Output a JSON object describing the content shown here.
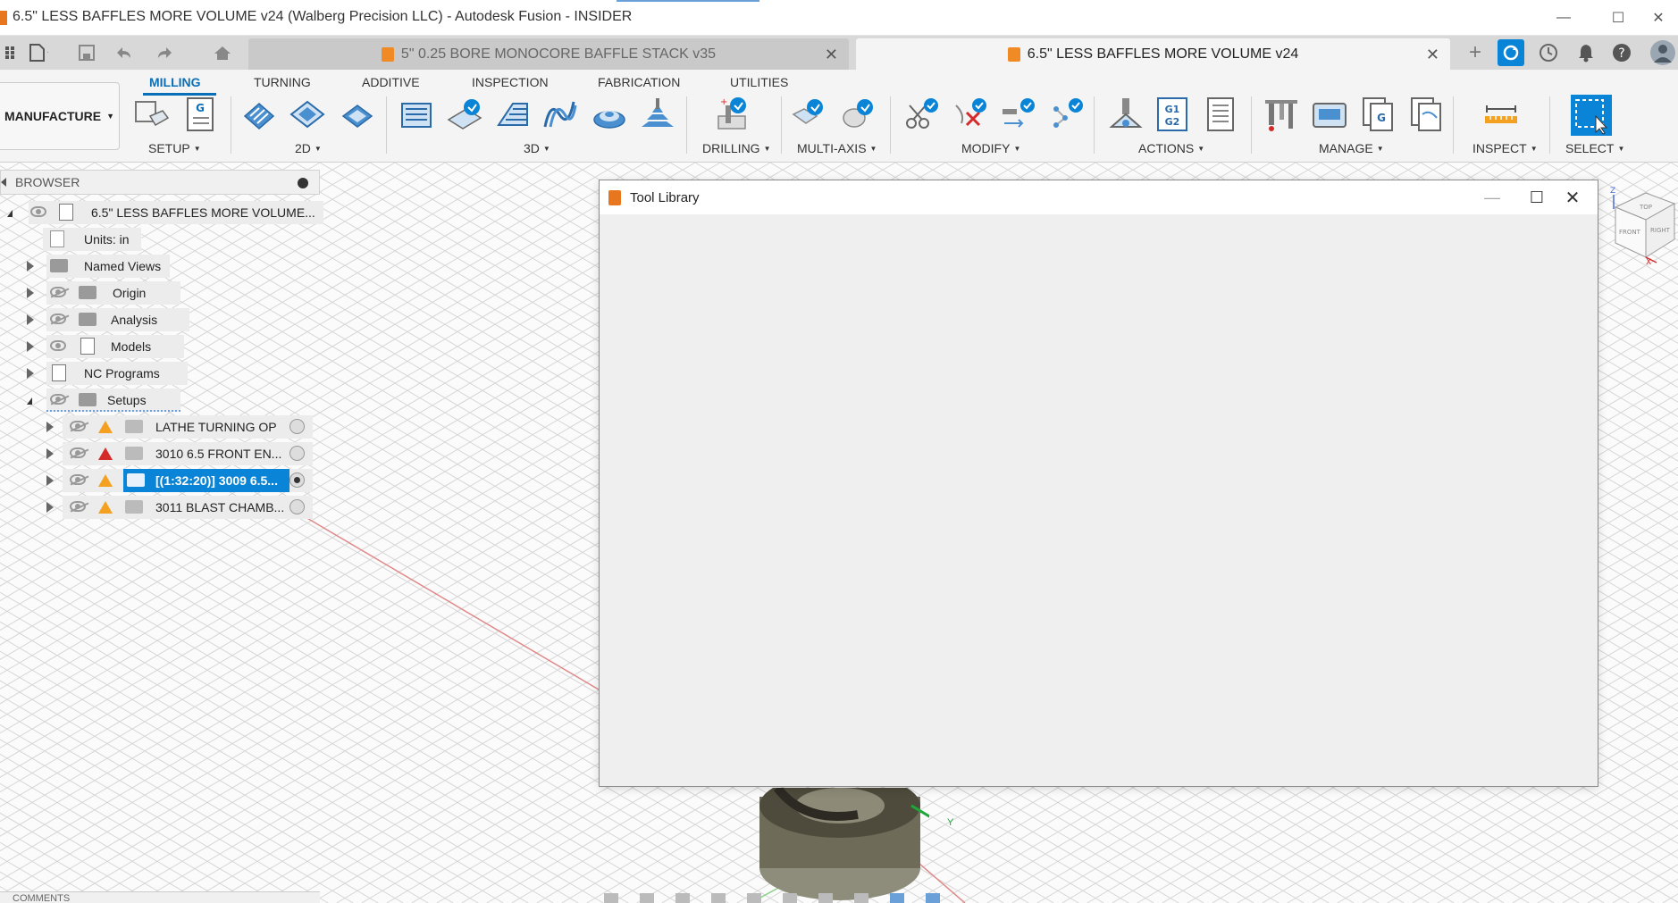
{
  "window": {
    "title": "6.5\" LESS BAFFLES MORE VOLUME v24 (Walberg Precision LLC) - Autodesk Fusion - INSIDER",
    "minimize": "—",
    "maximize": "☐",
    "close": "✕"
  },
  "tabs": [
    {
      "label": "5\"  0.25 BORE MONOCORE BAFFLE STACK v35",
      "active": false,
      "close": "✕"
    },
    {
      "label": "6.5\" LESS BAFFLES MORE VOLUME v24",
      "active": true,
      "close": "✕"
    }
  ],
  "tabbar_right": {
    "new_tab": "+"
  },
  "ribbon": {
    "workspace": "MANUFACTURE",
    "tabs": [
      "MILLING",
      "TURNING",
      "ADDITIVE",
      "INSPECTION",
      "FABRICATION",
      "UTILITIES"
    ],
    "active_tab": "MILLING",
    "groups": [
      "SETUP",
      "2D",
      "3D",
      "DRILLING",
      "MULTI-AXIS",
      "MODIFY",
      "ACTIONS",
      "MANAGE",
      "INSPECT",
      "SELECT"
    ]
  },
  "browser": {
    "header": "BROWSER",
    "root": "6.5\" LESS BAFFLES MORE VOLUME...",
    "units": "Units: in",
    "items": [
      "Named Views",
      "Origin",
      "Analysis",
      "Models",
      "NC Programs",
      "Setups"
    ],
    "setups": [
      {
        "label": "LATHE TURNING OP",
        "warning": "orange",
        "active": false
      },
      {
        "label": "3010 6.5 FRONT EN...",
        "warning": "red",
        "active": false
      },
      {
        "label": "[(1:32:20)] 3009 6.5...",
        "warning": "orange",
        "active": true
      },
      {
        "label": "3011 BLAST CHAMB...",
        "warning": "orange",
        "active": false
      }
    ]
  },
  "dialog": {
    "title": "Tool Library",
    "minimize": "—",
    "maximize": "☐",
    "close": "✕"
  },
  "viewcube": {
    "top": "TOP",
    "front": "FRONT",
    "right": "RIGHT",
    "z": "Z",
    "x": "X"
  },
  "triad": {
    "y": "Y"
  },
  "comments": {
    "label": "COMMENTS"
  },
  "colors": {
    "accent": "#0a84d6",
    "brand": "#e8761e",
    "warning": "#f4a020",
    "error": "#d42a2a"
  }
}
